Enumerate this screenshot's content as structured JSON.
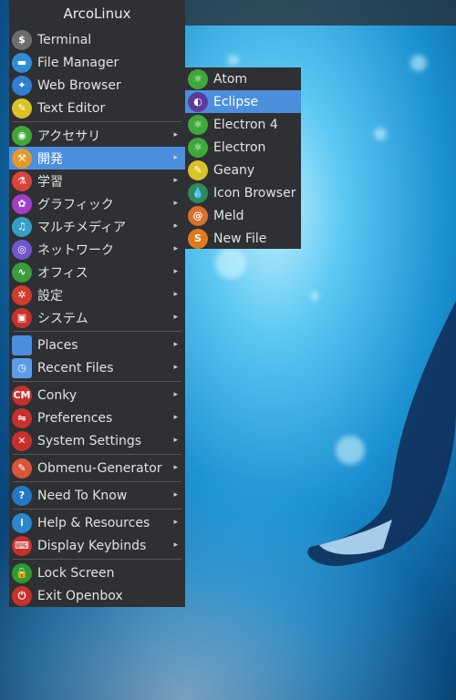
{
  "menu": {
    "title": "ArcoLinux",
    "items": [
      {
        "label": "Terminal",
        "icon": "terminal-icon",
        "color": "#6d6d6d",
        "glyph": "$",
        "submenu": false
      },
      {
        "label": "File Manager",
        "icon": "file-manager-icon",
        "color": "#2c8fd6",
        "glyph": "▬",
        "submenu": false
      },
      {
        "label": "Web Browser",
        "icon": "web-browser-icon",
        "color": "#2f7fd0",
        "glyph": "✦",
        "submenu": false
      },
      {
        "label": "Text Editor",
        "icon": "text-editor-icon",
        "color": "#d9c326",
        "glyph": "✎",
        "submenu": false
      },
      {
        "sep": true
      },
      {
        "label": "アクセサリ",
        "icon": "accessories-icon",
        "color": "#3fa83a",
        "glyph": "◉",
        "submenu": true
      },
      {
        "label": "開発",
        "icon": "development-icon",
        "color": "#e49a2a",
        "glyph": "⚒",
        "submenu": true,
        "active": true
      },
      {
        "label": "学習",
        "icon": "education-icon",
        "color": "#d8443a",
        "glyph": "⚗",
        "submenu": true
      },
      {
        "label": "グラフィック",
        "icon": "graphics-icon",
        "color": "#a43ec8",
        "glyph": "✿",
        "submenu": true
      },
      {
        "label": "マルチメディア",
        "icon": "multimedia-icon",
        "color": "#33a0c8",
        "glyph": "♫",
        "submenu": true
      },
      {
        "label": "ネットワーク",
        "icon": "network-icon",
        "color": "#7356c9",
        "glyph": "◎",
        "submenu": true
      },
      {
        "label": "オフィス",
        "icon": "office-icon",
        "color": "#3a9c3a",
        "glyph": "∿",
        "submenu": true
      },
      {
        "label": "設定",
        "icon": "settings-icon",
        "color": "#d33a2a",
        "glyph": "✲",
        "submenu": true
      },
      {
        "label": "システム",
        "icon": "system-icon",
        "color": "#c8322a",
        "glyph": "▣",
        "submenu": true
      },
      {
        "sep": true
      },
      {
        "label": "Places",
        "icon": "places-folder-icon",
        "color": "#4a8ee0",
        "glyph": "",
        "submenu": true,
        "square": true
      },
      {
        "label": "Recent Files",
        "icon": "recent-files-folder-icon",
        "color": "#5a9de6",
        "glyph": "◷",
        "submenu": true,
        "square": true
      },
      {
        "sep": true
      },
      {
        "label": "Conky",
        "icon": "conky-icon",
        "color": "#c8302c",
        "glyph": "CM",
        "submenu": true
      },
      {
        "label": "Preferences",
        "icon": "preferences-icon",
        "color": "#c8302c",
        "glyph": "⇋",
        "submenu": true
      },
      {
        "label": "System Settings",
        "icon": "system-settings-icon",
        "color": "#c8302c",
        "glyph": "✕",
        "submenu": true
      },
      {
        "sep": true
      },
      {
        "label": "Obmenu-Generator",
        "icon": "obmenu-generator-icon",
        "color": "#d9553a",
        "glyph": "✎",
        "submenu": true
      },
      {
        "sep": true
      },
      {
        "label": "Need To Know",
        "icon": "need-to-know-icon",
        "color": "#2478c8",
        "glyph": "?",
        "submenu": true
      },
      {
        "sep": true
      },
      {
        "label": "Help & Resources",
        "icon": "help-resources-icon",
        "color": "#2a88d0",
        "glyph": "i",
        "submenu": true
      },
      {
        "label": "Display Keybinds",
        "icon": "keyboard-icon",
        "color": "#c8302c",
        "glyph": "⌨",
        "submenu": true
      },
      {
        "sep": true
      },
      {
        "label": "Lock Screen",
        "icon": "lock-icon",
        "color": "#2f9a2f",
        "glyph": "🔒",
        "submenu": false
      },
      {
        "label": "Exit Openbox",
        "icon": "power-icon",
        "color": "#c8302c",
        "glyph": "⏻",
        "submenu": false
      }
    ]
  },
  "submenu": {
    "items": [
      {
        "label": "Atom",
        "icon": "atom-icon",
        "color": "#3fa83a",
        "glyph": "⚛"
      },
      {
        "label": "Eclipse",
        "icon": "eclipse-icon",
        "color": "#5c3b9c",
        "glyph": "◐",
        "active": true
      },
      {
        "label": "Electron 4",
        "icon": "electron-icon",
        "color": "#3fa83a",
        "glyph": "⚛"
      },
      {
        "label": "Electron",
        "icon": "electron-icon",
        "color": "#3fa83a",
        "glyph": "⚛"
      },
      {
        "label": "Geany",
        "icon": "geany-icon",
        "color": "#d9c326",
        "glyph": "✎"
      },
      {
        "label": "Icon Browser",
        "icon": "icon-browser-icon",
        "color": "#2f8a5a",
        "glyph": "💧"
      },
      {
        "label": "Meld",
        "icon": "meld-icon",
        "color": "#d9702a",
        "glyph": "@"
      },
      {
        "label": "New File",
        "icon": "new-file-icon",
        "color": "#e07a1c",
        "glyph": "S"
      }
    ]
  }
}
